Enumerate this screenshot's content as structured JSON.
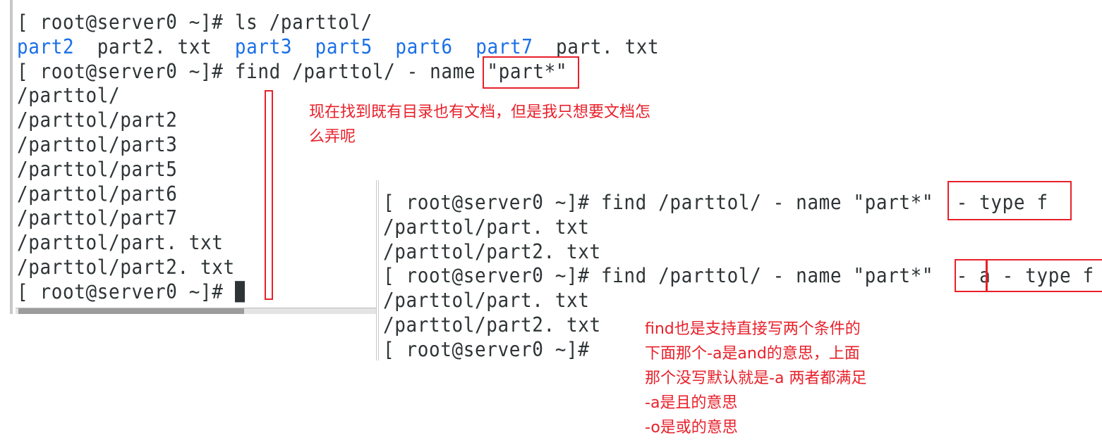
{
  "left_terminal": {
    "lines": [
      [
        {
          "t": "[ root@server0 ~]# ls /parttol/",
          "c": "normal"
        }
      ],
      [
        {
          "t": "part2",
          "c": "blue"
        },
        {
          "t": "  part2. txt  ",
          "c": "normal"
        },
        {
          "t": "part3",
          "c": "blue"
        },
        {
          "t": "  ",
          "c": "normal"
        },
        {
          "t": "part5",
          "c": "blue"
        },
        {
          "t": "  ",
          "c": "normal"
        },
        {
          "t": "part6",
          "c": "blue"
        },
        {
          "t": "  ",
          "c": "normal"
        },
        {
          "t": "part7",
          "c": "blue"
        },
        {
          "t": "  part. txt",
          "c": "normal"
        }
      ],
      [
        {
          "t": "[ root@server0 ~]# find /parttol/ - name \"part*\"",
          "c": "normal"
        }
      ],
      [
        {
          "t": "/parttol/",
          "c": "normal"
        }
      ],
      [
        {
          "t": "/parttol/part2",
          "c": "normal"
        }
      ],
      [
        {
          "t": "/parttol/part3",
          "c": "normal"
        }
      ],
      [
        {
          "t": "/parttol/part5",
          "c": "normal"
        }
      ],
      [
        {
          "t": "/parttol/part6",
          "c": "normal"
        }
      ],
      [
        {
          "t": "/parttol/part7",
          "c": "normal"
        }
      ],
      [
        {
          "t": "/parttol/part. txt",
          "c": "normal"
        }
      ],
      [
        {
          "t": "/parttol/part2. txt",
          "c": "normal"
        }
      ],
      [
        {
          "t": "[ root@server0 ~]# ",
          "c": "normal"
        }
      ]
    ]
  },
  "right_terminal": {
    "lines": [
      "[ root@server0 ~]# find /parttol/ - name \"part*\"  - type f",
      "/parttol/part. txt",
      "/parttol/part2. txt",
      "[ root@server0 ~]# find /parttol/ - name \"part*\"  - a - type f",
      "/parttol/part. txt",
      "/parttol/part2. txt",
      "[ root@server0 ~]#"
    ]
  },
  "annotations": {
    "note1": [
      "现在找到既有目录也有文档，但是我只想要文档怎",
      "么弄呢"
    ],
    "note2": [
      "find也是支持直接写两个条件的",
      "下面那个-a是and的意思，上面",
      "那个没写默认就是-a 两者都满足",
      "-a是且的意思",
      "-o是或的意思"
    ]
  },
  "colors": {
    "annotation": "#e8202a",
    "directory": "#1a6fe8",
    "text": "#2e3436"
  }
}
